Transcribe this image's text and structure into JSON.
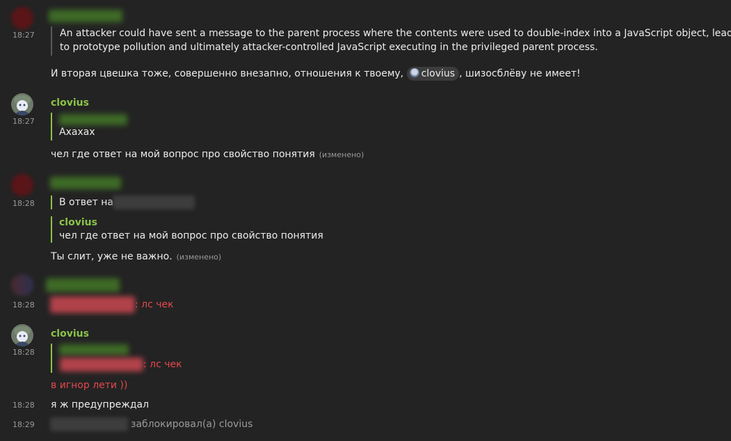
{
  "messages": {
    "m1": {
      "time": "18:27",
      "quote_line1": "An attacker could have sent a message to the parent process where the contents were used to double-index into a JavaScript object, leading",
      "quote_line2": "to prototype pollution and ultimately attacker-controlled JavaScript executing in the privileged parent process.",
      "text_before": "И вторая цвешка тоже, совершенно внезапно, отношения к твоему,",
      "mention": "clovius",
      "text_after": ", шизосблёву не имеет!"
    },
    "m2": {
      "time": "18:27",
      "author": "clovius",
      "reply_text": "Ахахах",
      "text": "чел где ответ на мой вопрос про свойство понятия",
      "edited": "(изменено)"
    },
    "m3": {
      "time": "18:28",
      "reply_prefix": "В ответ на",
      "quote_author": "clovius",
      "quote_text": "чел где ответ на мой вопрос про свойство понятия",
      "text": "Ты слит, уже не важно.",
      "edited": "(изменено)"
    },
    "m4": {
      "time": "18:28",
      "text_suffix": ": лс чек"
    },
    "m5": {
      "time": "18:28",
      "author": "clovius",
      "reply_suffix": ": лс чек",
      "text": "в игнор лети ))"
    },
    "m6": {
      "time": "18:28",
      "text": "я ж предупреждал"
    },
    "m7": {
      "time": "18:29",
      "text": "заблокировал(а) clovius"
    }
  },
  "colors": {
    "background": "#232323",
    "username": "#8bc34a",
    "highlight_red": "#e5484d",
    "timestamp": "#9a9a9a"
  },
  "icons": {
    "avatar_clovius": "clovius-avatar-icon"
  }
}
